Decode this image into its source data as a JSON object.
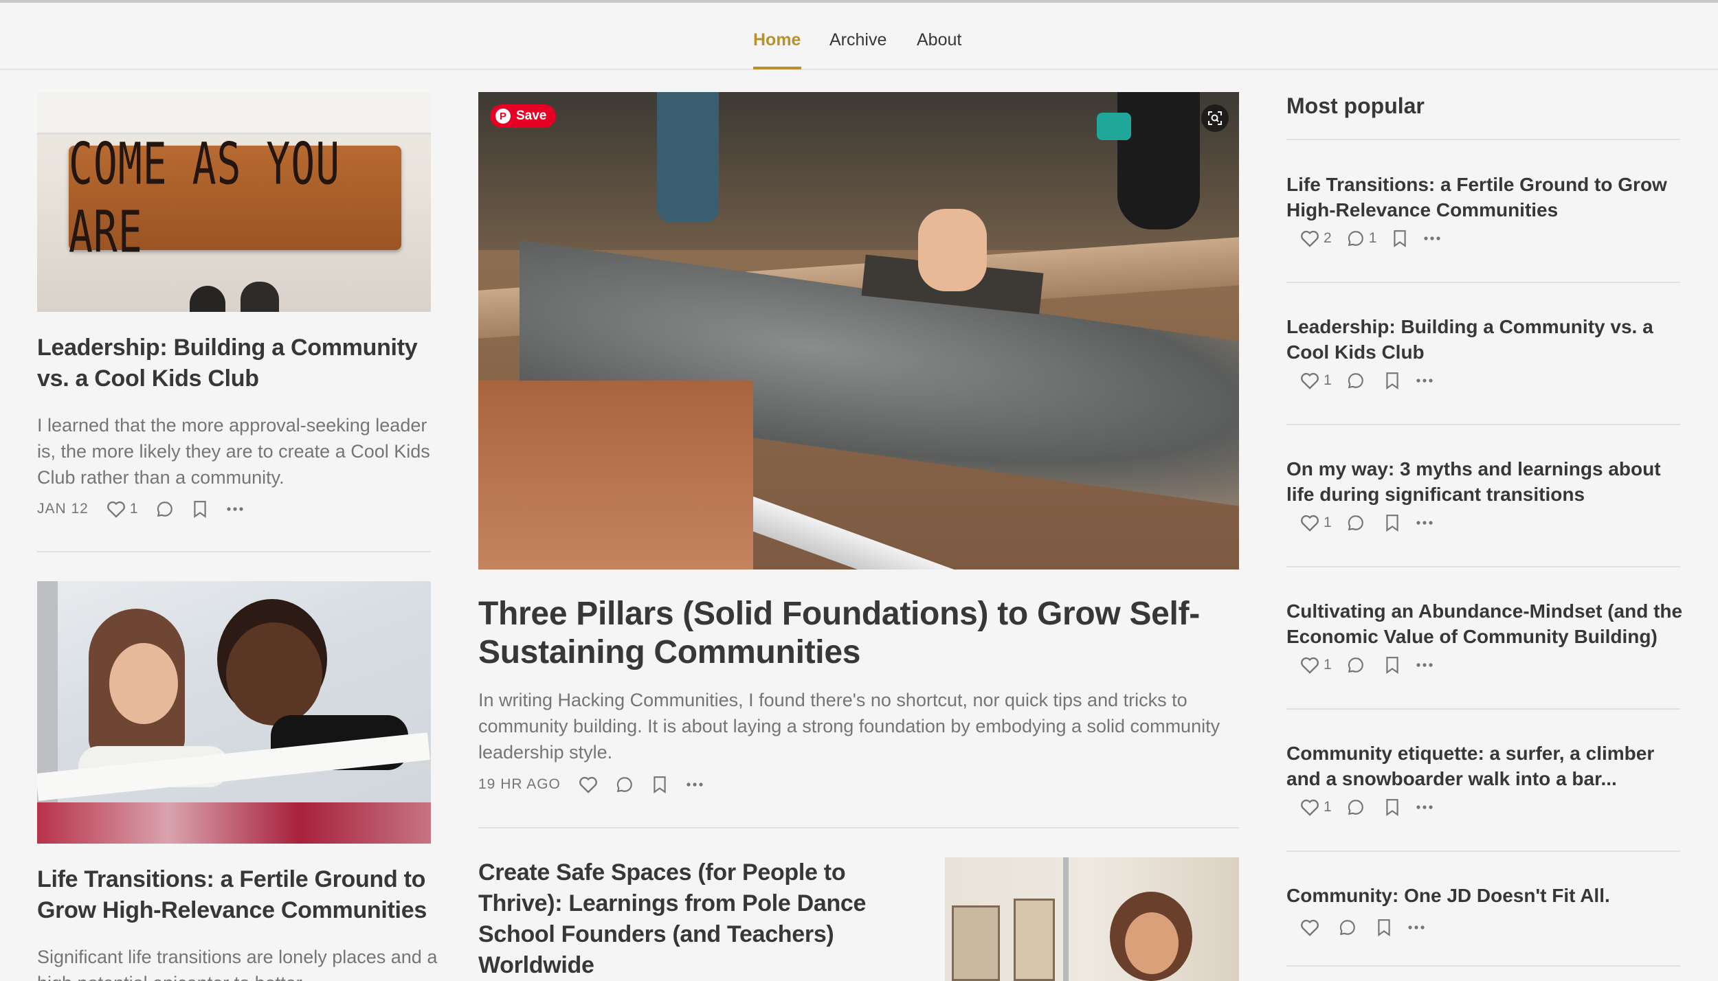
{
  "nav": {
    "items": [
      "Home",
      "Archive",
      "About"
    ],
    "active": "Home"
  },
  "posts": [
    {
      "title": "Leadership: Building a Community vs. a Cool Kids Club",
      "excerpt": "I learned that the more approval-seeking leader is, the more likely they are to create a Cool Kids Club rather than a community.",
      "date": "JAN 12",
      "likes": "1",
      "image_text": "COME AS YOU ARE"
    },
    {
      "title": "Life Transitions: a Fertile Ground to Grow High-Relevance Communities",
      "excerpt": "Significant life transitions are lonely places and a high potential epicenter to better..."
    },
    {
      "title": "Three Pillars (Solid Foundations) to Grow Self-Sustaining Communities",
      "excerpt": "In writing Hacking Communities, I found there's no shortcut, nor quick tips and tricks to community building. It is about laying a strong foundation by embodying a solid community leadership style.",
      "date": "19 HR AGO",
      "save_label": "Save"
    },
    {
      "title": "Create Safe Spaces (for People to Thrive): Learnings from Pole Dance School Founders (and Teachers) Worldwide"
    }
  ],
  "popular": {
    "heading": "Most popular",
    "items": [
      {
        "title": "Life Transitions: a Fertile Ground to Grow High-Relevance Communities",
        "likes": "2",
        "comments": "1"
      },
      {
        "title": "Leadership: Building a Community vs. a Cool Kids Club",
        "likes": "1",
        "comments": ""
      },
      {
        "title": "On my way: 3 myths and learnings about life during significant transitions",
        "likes": "1",
        "comments": ""
      },
      {
        "title": "Cultivating an Abundance-Mindset (and the Economic Value of Community Building)",
        "likes": "1",
        "comments": ""
      },
      {
        "title": "Community etiquette: a surfer, a climber and a snowboarder walk into a bar...",
        "likes": "1",
        "comments": ""
      },
      {
        "title": "Community: One JD Doesn't Fit All.",
        "likes": "",
        "comments": ""
      }
    ]
  },
  "colors": {
    "accent": "#b8912a",
    "text": "#363737",
    "muted": "#757575",
    "background": "#f5f5f5",
    "pinterest": "#e60023"
  }
}
